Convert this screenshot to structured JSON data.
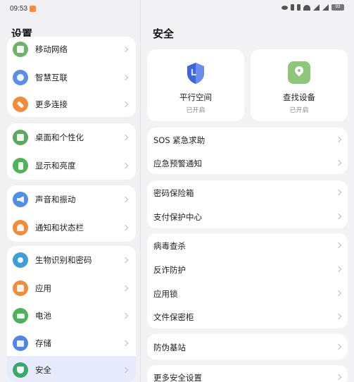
{
  "status_bar": {
    "time": "09:53",
    "battery": "93"
  },
  "left": {
    "title": "设置",
    "items": [
      {
        "label": "移动网络",
        "icon": "mobile-network-icon",
        "color": "#6fb36a"
      },
      {
        "label": "智慧互联",
        "icon": "smart-connect-icon",
        "color": "#5b8ee8"
      },
      {
        "label": "更多连接",
        "icon": "link-icon",
        "color": "#f08c3a"
      },
      {
        "label": "桌面和个性化",
        "icon": "wallpaper-icon",
        "color": "#5aaa5e"
      },
      {
        "label": "显示和亮度",
        "icon": "display-icon",
        "color": "#4fb35a"
      },
      {
        "label": "声音和振动",
        "icon": "sound-icon",
        "color": "#4f8fe8"
      },
      {
        "label": "通知和状态栏",
        "icon": "bell-icon",
        "color": "#f08c3a"
      },
      {
        "label": "生物识别和密码",
        "icon": "key-icon",
        "color": "#3f9ed8"
      },
      {
        "label": "应用",
        "icon": "apps-icon",
        "color": "#f08c3a"
      },
      {
        "label": "电池",
        "icon": "battery-icon",
        "color": "#4cb35a"
      },
      {
        "label": "存储",
        "icon": "storage-icon",
        "color": "#4f86e8"
      },
      {
        "label": "安全",
        "icon": "security-icon",
        "color": "#3aa86a"
      }
    ]
  },
  "right": {
    "title": "安全",
    "cards": [
      {
        "name": "平行空间",
        "state": "已开启",
        "icon": "parallel-space-shield-icon"
      },
      {
        "name": "查找设备",
        "state": "已开启",
        "icon": "find-device-icon"
      }
    ],
    "items": [
      "SOS 紧急求助",
      "应急预警通知",
      "密码保险箱",
      "支付保护中心",
      "病毒查杀",
      "反诈防护",
      "应用锁",
      "文件保密柜",
      "防伪基站",
      "更多安全设置"
    ]
  }
}
